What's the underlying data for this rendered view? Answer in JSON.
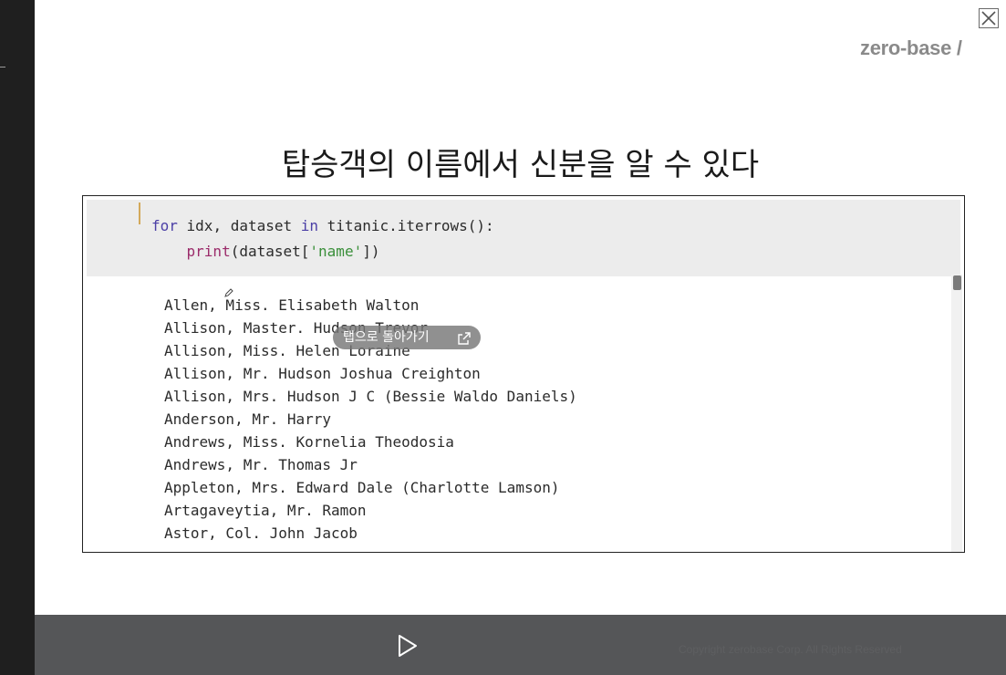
{
  "slide": {
    "logo": "zero-base /",
    "title": "탑승객의 이름에서 신분을 알 수 있다",
    "code": {
      "line1": {
        "kw_for": "for",
        "part1": " idx, dataset ",
        "kw_in": "in",
        "part2": " titanic.iterrows():"
      },
      "line2": {
        "indent": "    ",
        "fn": "print",
        "part1": "(dataset[",
        "str": "'name'",
        "part2": "])"
      }
    },
    "output": [
      "Allen, Miss. Elisabeth Walton",
      "Allison, Master. Hudson Trevor",
      "Allison, Miss. Helen Loraine",
      "Allison, Mr. Hudson Joshua Creighton",
      "Allison, Mrs. Hudson J C (Bessie Waldo Daniels)",
      "Anderson, Mr. Harry",
      "Andrews, Miss. Kornelia Theodosia",
      "Andrews, Mr. Thomas Jr",
      "Appleton, Mrs. Edward Dale (Charlotte Lamson)",
      "Artagaveytia, Mr. Ramon",
      "Astor, Col. John Jacob"
    ]
  },
  "overlay": {
    "back_to_tab": "탭으로 돌아가기"
  },
  "player": {
    "copyright": "Copyright zerobase Corp. All Rights Reserved"
  },
  "icons": {
    "close": "close-icon",
    "play": "play-icon",
    "external": "external-link-icon",
    "pencil": "pencil-icon"
  },
  "colors": {
    "keyword": "#4b3fa6",
    "function": "#9b2b6a",
    "string": "#3a8f3a",
    "code_cell_bg": "#ececec",
    "bottom_bar": "#555658"
  }
}
